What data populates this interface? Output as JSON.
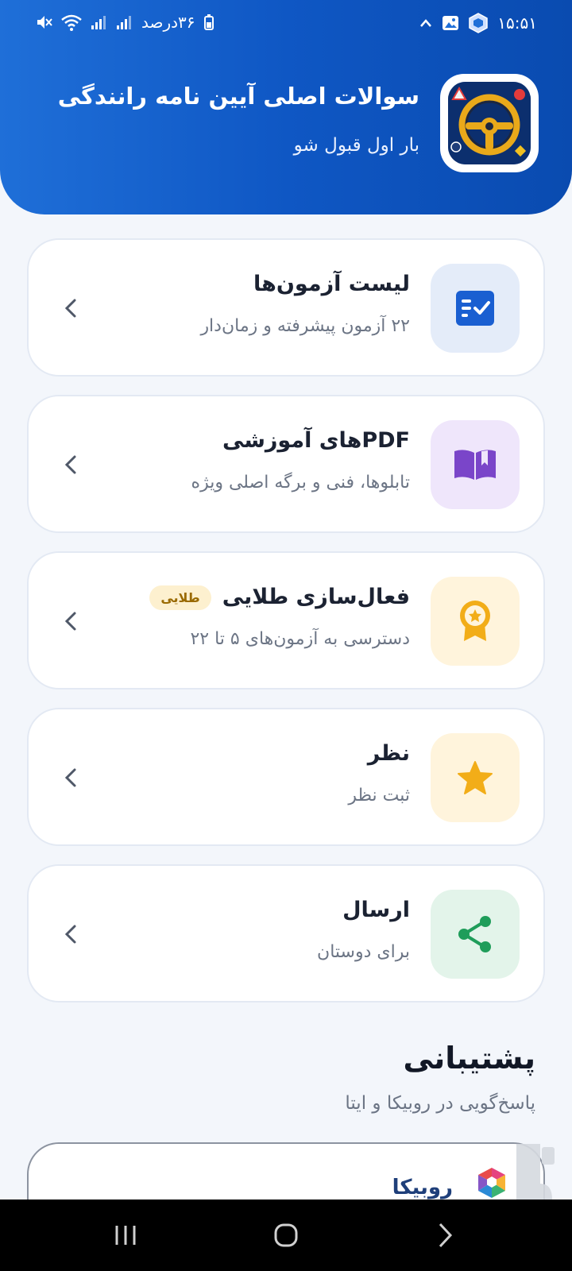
{
  "status_bar": {
    "time": "۱۵:۵۱",
    "battery_text": "۳۶درصد"
  },
  "header": {
    "title": "سوالات اصلی آیین نامه رانندگی",
    "subtitle": "بار اول قبول شو",
    "app_icon": "steering-wheel-icon"
  },
  "menu": [
    {
      "title": "لیست آزمون‌ها",
      "subtitle": "۲۲ آزمون پیشرفته و زمان‌دار",
      "icon": "checklist-icon",
      "icon_bg": "#e4ecf9",
      "icon_color": "#1a5fd1"
    },
    {
      "title": "PDFهای آموزشی",
      "subtitle": "تابلوها، فنی و برگه اصلی ویژه",
      "icon": "book-icon",
      "icon_bg": "#efe6fb",
      "icon_color": "#7a45c9"
    },
    {
      "title": "فعال‌سازی طلایی",
      "badge": "طلایی",
      "subtitle": "دسترسی به آزمون‌های ۵ تا ۲۲",
      "icon": "award-icon",
      "icon_bg": "#fff4dc",
      "icon_color": "#f2ad18"
    },
    {
      "title": "نظر",
      "subtitle": "ثبت نظر",
      "icon": "star-icon",
      "icon_bg": "#fff4dc",
      "icon_color": "#f2ad18"
    },
    {
      "title": "ارسال",
      "subtitle": "برای دوستان",
      "icon": "share-icon",
      "icon_bg": "#e3f4ea",
      "icon_color": "#1f9d5a"
    }
  ],
  "support": {
    "title": "پشتیبانی",
    "subtitle": "پاسخ‌گویی در روبیکا و ایتا",
    "rubika_label": "روبیکا"
  }
}
